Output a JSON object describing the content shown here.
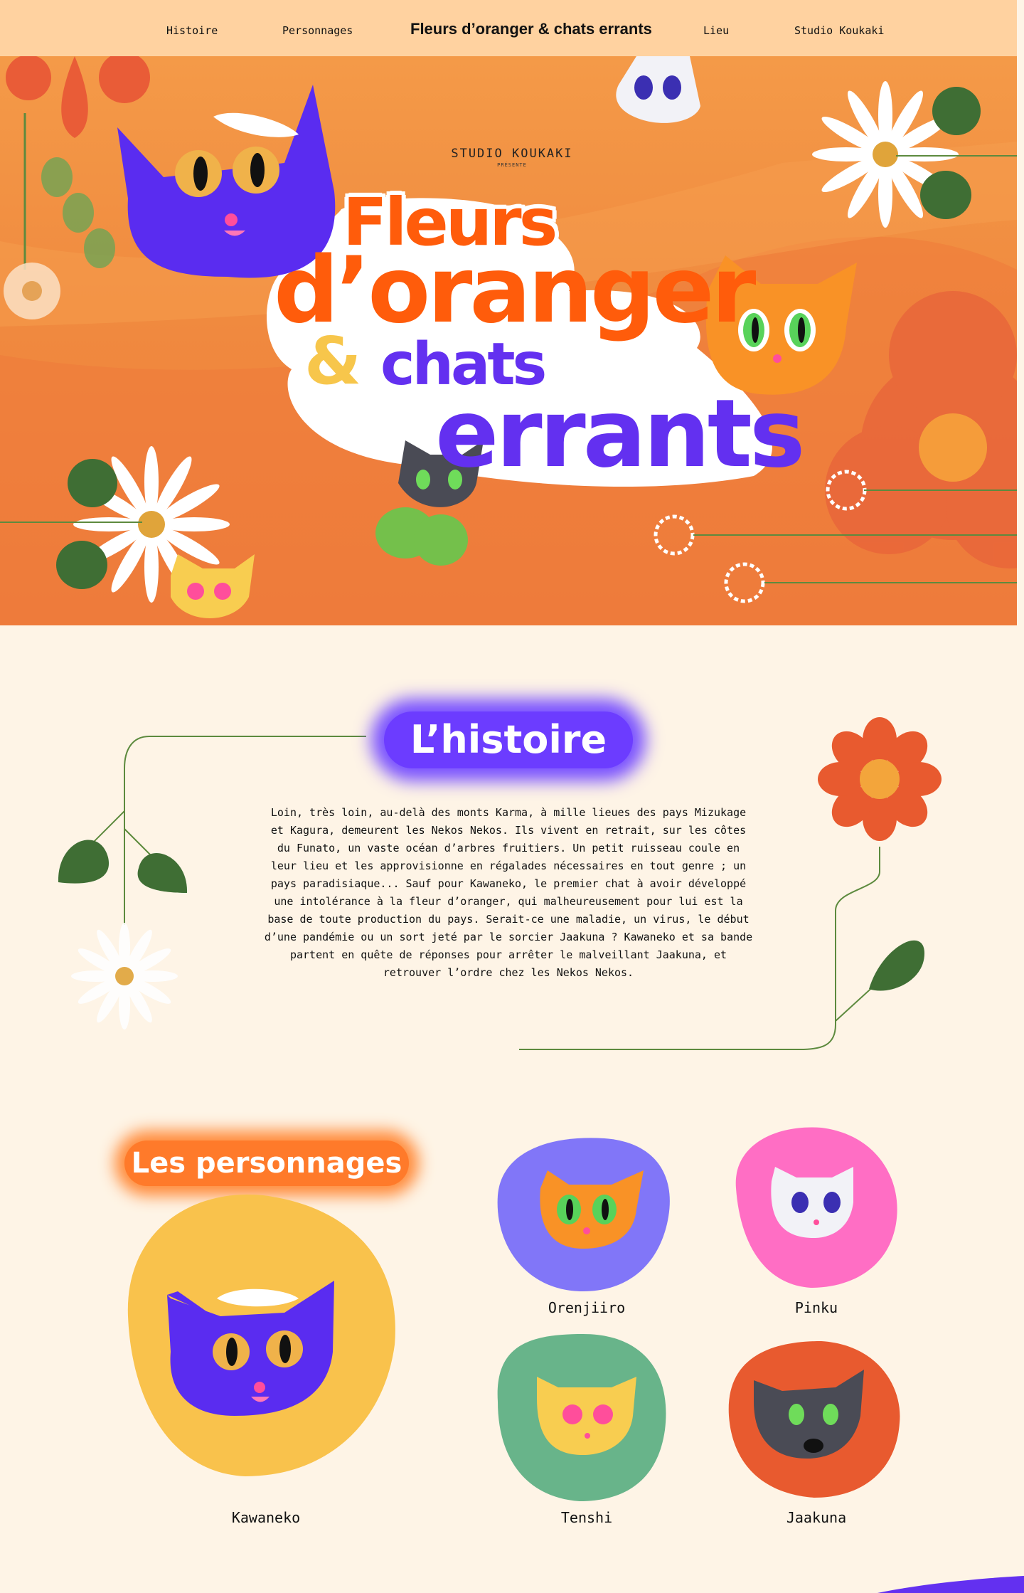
{
  "nav": {
    "links": [
      "Histoire",
      "Personnages",
      "Lieu",
      "Studio Koukaki"
    ],
    "title": "Fleurs d’oranger & chats errants"
  },
  "hero": {
    "studio": "STUDIO KOUKAKI",
    "presents": "PRÉSENTE",
    "title_words": [
      "Fleurs",
      "d’oranger",
      "&",
      "chats",
      "errants"
    ]
  },
  "histoire": {
    "title": "L’histoire",
    "text": "Loin, très loin, au-delà des monts Karma, à mille lieues des pays Mizukage et Kagura, demeurent les Nekos Nekos. Ils vivent en retrait, sur les côtes du Funato, un vaste océan d’arbres fruitiers. Un petit ruisseau coule en leur lieu et les approvisionne en régalades nécessaires en tout genre ; un pays paradisiaque... Sauf pour Kawaneko, le premier chat à avoir développé une intolérance à la fleur d’oranger, qui malheureusement pour lui est la base de toute production du pays. Serait-ce une maladie, un virus, le début d’une pandémie ou un sort jeté par le sorcier Jaakuna ? Kawaneko et sa bande partent en quête de réponses pour arrêter le malveillant Jaakuna, et retrouver l’ordre chez les Nekos Nekos."
  },
  "personnages": {
    "title": "Les personnages",
    "characters": [
      {
        "name": "Kawaneko",
        "color": "#f9c24c"
      },
      {
        "name": "Orenjiiro",
        "color": "#8176f8"
      },
      {
        "name": "Pinku",
        "color": "#ff6ec4"
      },
      {
        "name": "Tenshi",
        "color": "#68b48a"
      },
      {
        "name": "Jaakuna",
        "color": "#e85a2f"
      }
    ]
  },
  "colors": {
    "nav_bg": "#ffd2a0",
    "page_bg": "#fef4e6",
    "orange": "#ff5c0b",
    "purple": "#6330f0",
    "yellow": "#f7c64b",
    "leaf": "#3f6e34"
  }
}
